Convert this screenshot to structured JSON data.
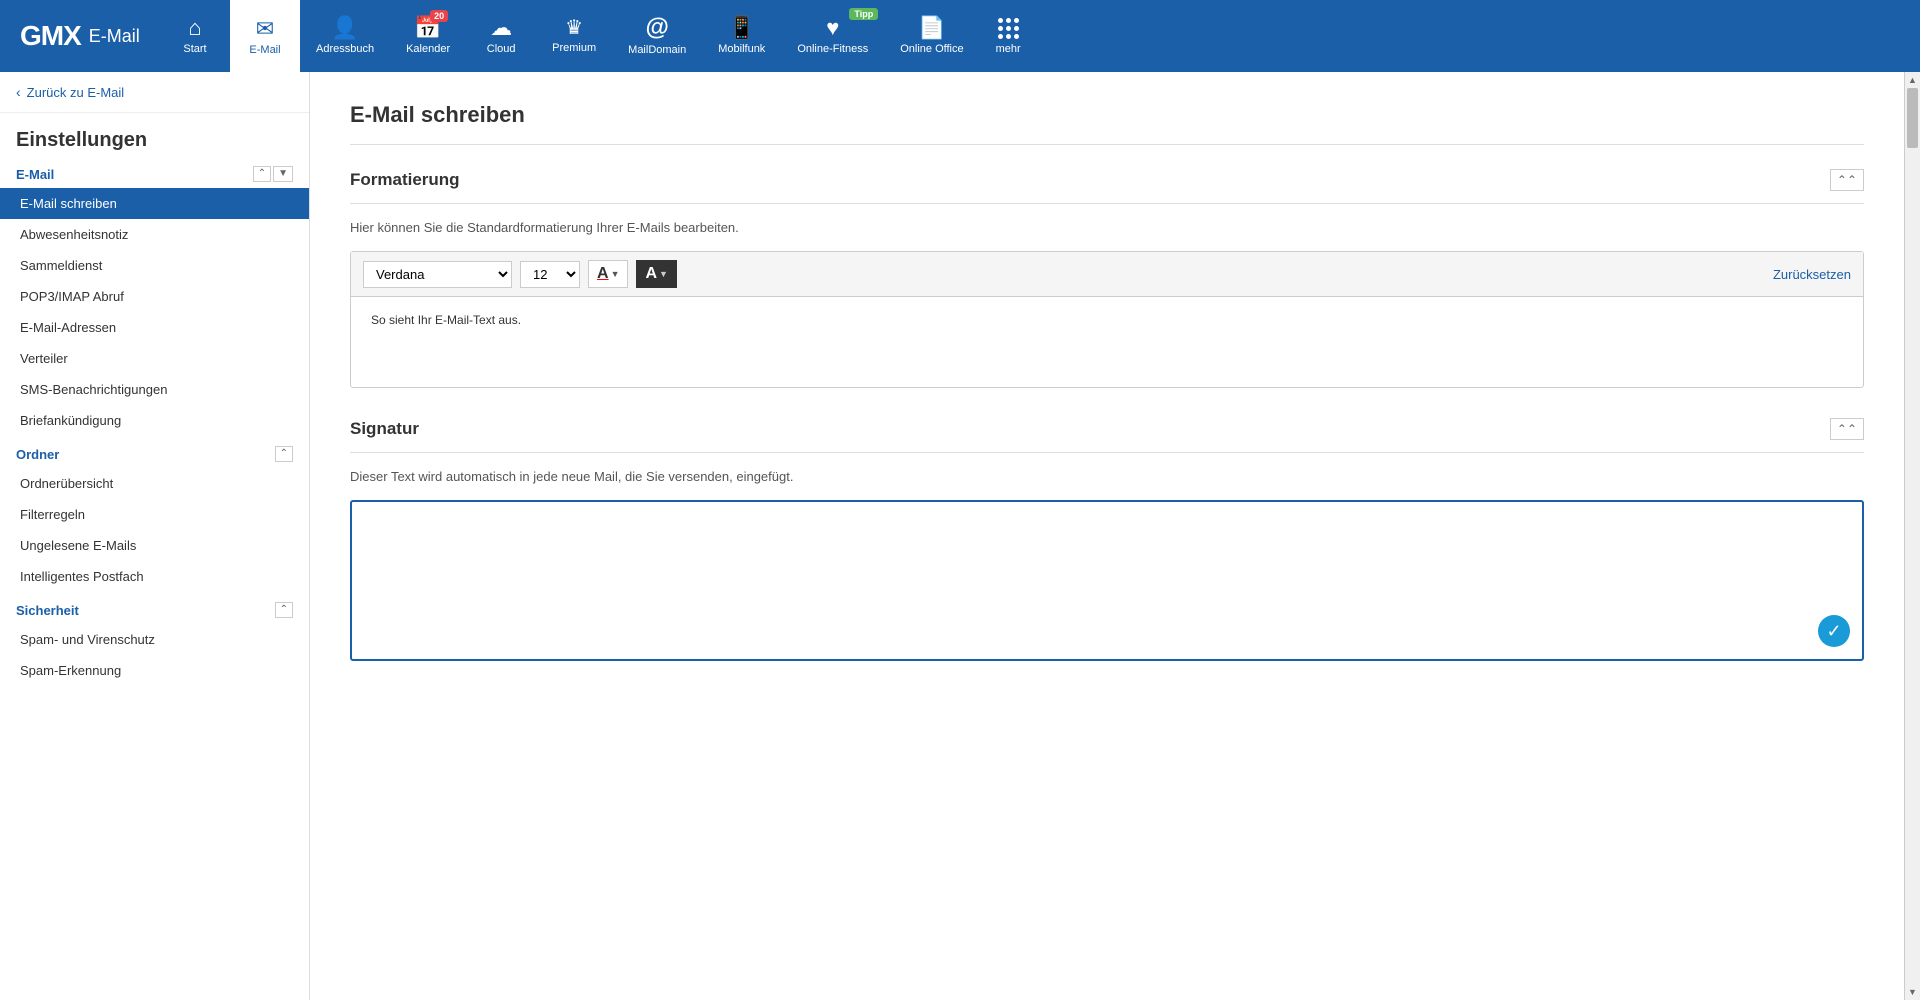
{
  "logo": {
    "gmx": "GMX",
    "separator": " ",
    "email": "E-Mail"
  },
  "nav": {
    "items": [
      {
        "id": "start",
        "label": "Start",
        "icon": "🏠",
        "active": false
      },
      {
        "id": "email",
        "label": "E-Mail",
        "icon": "✉",
        "active": true
      },
      {
        "id": "adressbuch",
        "label": "Adressbuch",
        "icon": "👤",
        "active": false
      },
      {
        "id": "kalender",
        "label": "Kalender",
        "icon": "📅",
        "badge": "20",
        "active": false
      },
      {
        "id": "cloud",
        "label": "Cloud",
        "icon": "☁",
        "active": false
      },
      {
        "id": "premium",
        "label": "Premium",
        "icon": "♛",
        "active": false
      },
      {
        "id": "maildomain",
        "label": "MailDomain",
        "icon": "@",
        "active": false
      },
      {
        "id": "mobilfunk",
        "label": "Mobilfunk",
        "icon": "📱",
        "active": false
      },
      {
        "id": "online-fitness",
        "label": "Online-Fitness",
        "icon": "♥",
        "tipp": "Tipp",
        "active": false
      },
      {
        "id": "online-office",
        "label": "Online Office",
        "icon": "📄",
        "active": false
      },
      {
        "id": "mehr",
        "label": "mehr",
        "icon": "grid",
        "active": false
      }
    ]
  },
  "sidebar": {
    "back_label": "Zurück zu E-Mail",
    "title": "Einstellungen",
    "sections": [
      {
        "id": "email",
        "title": "E-Mail",
        "items": [
          {
            "id": "email-schreiben",
            "label": "E-Mail schreiben",
            "active": true
          },
          {
            "id": "abwesenheitsnotiz",
            "label": "Abwesenheitsnotiz",
            "active": false
          },
          {
            "id": "sammeldienst",
            "label": "Sammeldienst",
            "active": false
          },
          {
            "id": "pop3imap",
            "label": "POP3/IMAP Abruf",
            "active": false
          },
          {
            "id": "email-adressen",
            "label": "E-Mail-Adressen",
            "active": false
          },
          {
            "id": "verteiler",
            "label": "Verteiler",
            "active": false
          },
          {
            "id": "sms-benachrichtigungen",
            "label": "SMS-Benachrichtigungen",
            "active": false
          },
          {
            "id": "briefankuendigung",
            "label": "Briefankündigung",
            "active": false
          }
        ]
      },
      {
        "id": "ordner",
        "title": "Ordner",
        "items": [
          {
            "id": "ordneruebersicht",
            "label": "Ordnerübersicht",
            "active": false
          },
          {
            "id": "filterregeln",
            "label": "Filterregeln",
            "active": false
          },
          {
            "id": "ungelesene-emails",
            "label": "Ungelesene E-Mails",
            "active": false
          },
          {
            "id": "intelligentes-postfach",
            "label": "Intelligentes Postfach",
            "active": false
          }
        ]
      },
      {
        "id": "sicherheit",
        "title": "Sicherheit",
        "items": [
          {
            "id": "spam-virenschutz",
            "label": "Spam- und Virenschutz",
            "active": false
          },
          {
            "id": "spam-erkennung",
            "label": "Spam-Erkennung",
            "active": false
          }
        ]
      }
    ]
  },
  "content": {
    "page_title": "E-Mail schreiben",
    "sections": [
      {
        "id": "formatierung",
        "heading": "Formatierung",
        "description": "Hier können Sie die Standardformatierung Ihrer E-Mails bearbeiten.",
        "toolbar": {
          "font": "Verdana",
          "font_placeholder": "Verdana",
          "size": "12",
          "reset_label": "Zurücksetzen"
        },
        "preview_text": "So sieht Ihr E-Mail-Text aus."
      },
      {
        "id": "signatur",
        "heading": "Signatur",
        "description": "Dieser Text wird automatisch in jede neue Mail, die Sie versenden, eingefügt.",
        "signature_text": ""
      }
    ]
  }
}
